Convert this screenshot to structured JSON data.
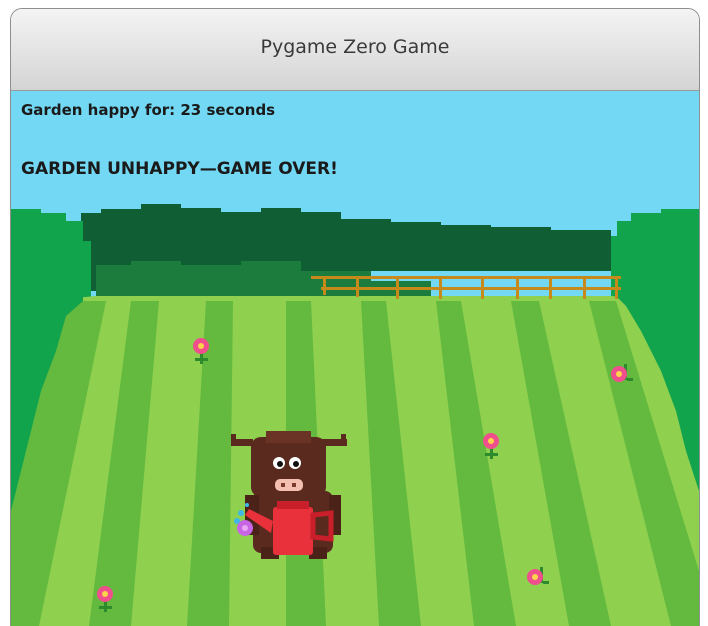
{
  "window": {
    "title": "Pygame Zero Game"
  },
  "hud": {
    "timer_text": "Garden happy for: 23 seconds",
    "status_text": "GARDEN UNHAPPY—GAME OVER!"
  },
  "colors": {
    "sky": "#73d8f3",
    "grass_light": "#8fd04f",
    "grass_dark": "#63ba3e",
    "hedge_dark": "#0f5e34",
    "hedge_mid": "#1c7c3e",
    "bush_side": "#12a34d",
    "fence": "#c68a1b",
    "flower_pink": "#ef4f8c",
    "stem": "#2d8a2d",
    "cow_brown": "#5a2a1f",
    "watering_can": "#e8313b"
  },
  "sprites": {
    "player": "cow-with-watering-can",
    "flowers": [
      "flower",
      "flower",
      "flower",
      "flower",
      "flower"
    ]
  }
}
